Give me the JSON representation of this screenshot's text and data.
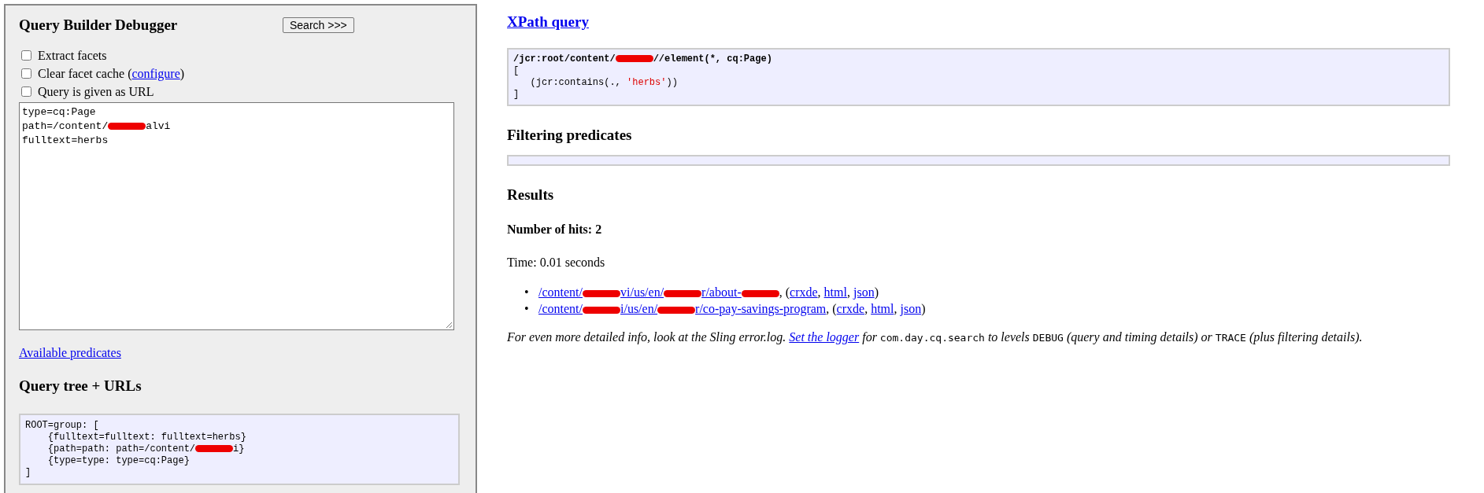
{
  "left_panel": {
    "title": "Query Builder Debugger",
    "search_button": "Search >>>",
    "options": [
      {
        "label": [
          {
            "text": "Extract facets"
          }
        ],
        "checked": false
      },
      {
        "label": [
          {
            "text": "Clear facet cache ("
          },
          {
            "kind": "link",
            "text": "configure"
          },
          {
            "text": ")"
          }
        ],
        "checked": false
      },
      {
        "label": [
          {
            "text": "Query is given as URL"
          }
        ],
        "checked": false
      }
    ],
    "query_lines": [
      [
        {
          "text": "type=cq:Page"
        }
      ],
      [
        {
          "text": "path=/content/"
        },
        {
          "kind": "redacted"
        },
        {
          "text": "alvi"
        }
      ],
      [
        {
          "text": "fulltext=herbs"
        }
      ]
    ],
    "predicates_link": "Available predicates",
    "tree_heading": "Query tree + URLs",
    "tree_lines": [
      [
        {
          "text": "ROOT=group: ["
        }
      ],
      [
        {
          "text": "    {fulltext=fulltext: fulltext=herbs}"
        }
      ],
      [
        {
          "text": "    {path=path: path=/content/"
        },
        {
          "kind": "redacted"
        },
        {
          "text": "i}"
        }
      ],
      [
        {
          "text": "    {type=type: type=cq:Page}"
        }
      ],
      [
        {
          "text": "]"
        }
      ]
    ]
  },
  "xpath": {
    "heading": "XPath query",
    "lines": [
      [
        {
          "text": "/jcr:root/content/",
          "kind": "bold"
        },
        {
          "kind": "redacted"
        },
        {
          "text": "//element(*, cq:Page)",
          "kind": "bold"
        }
      ],
      [
        {
          "text": "["
        }
      ],
      [
        {
          "text": "   (jcr:contains(., "
        },
        {
          "text": "'herbs'",
          "kind": "string"
        },
        {
          "text": "))"
        }
      ],
      [
        {
          "text": "]"
        }
      ]
    ]
  },
  "filtering": {
    "heading": "Filtering predicates"
  },
  "results": {
    "heading": "Results",
    "hits": "Number of hits: 2",
    "time": "Time: 0.01 seconds",
    "items": [
      {
        "bullet": "•",
        "path": [
          {
            "text": "/content/"
          },
          {
            "kind": "redacted"
          },
          {
            "text": "vi/us/en/"
          },
          {
            "kind": "redacted"
          },
          {
            "text": "r/about-"
          },
          {
            "kind": "redacted"
          }
        ],
        "tail": [
          {
            "text": ", ("
          },
          {
            "kind": "link",
            "text": "crxde"
          },
          {
            "text": ", "
          },
          {
            "kind": "link",
            "text": "html"
          },
          {
            "text": ", "
          },
          {
            "kind": "link",
            "text": "json"
          },
          {
            "text": ")"
          }
        ]
      },
      {
        "bullet": "•",
        "path": [
          {
            "text": "/content/"
          },
          {
            "kind": "redacted"
          },
          {
            "text": "i/us/en/"
          },
          {
            "kind": "redacted"
          },
          {
            "text": "r/co-pay-savings-program"
          }
        ],
        "tail": [
          {
            "text": ", ("
          },
          {
            "kind": "link",
            "text": "crxde"
          },
          {
            "text": ", "
          },
          {
            "kind": "link",
            "text": "html"
          },
          {
            "text": ", "
          },
          {
            "kind": "link",
            "text": "json"
          },
          {
            "text": ")"
          }
        ]
      }
    ],
    "note": [
      {
        "text": "For even more detailed info, look at the Sling error.log. "
      },
      {
        "kind": "link",
        "text": "Set the logger"
      },
      {
        "text": " for "
      },
      {
        "kind": "code",
        "text": "com.day.cq.search"
      },
      {
        "text": " to levels "
      },
      {
        "kind": "code",
        "text": "DEBUG"
      },
      {
        "text": " (query and timing details) or "
      },
      {
        "kind": "code",
        "text": "TRACE"
      },
      {
        "text": " (plus filtering details)."
      }
    ]
  }
}
